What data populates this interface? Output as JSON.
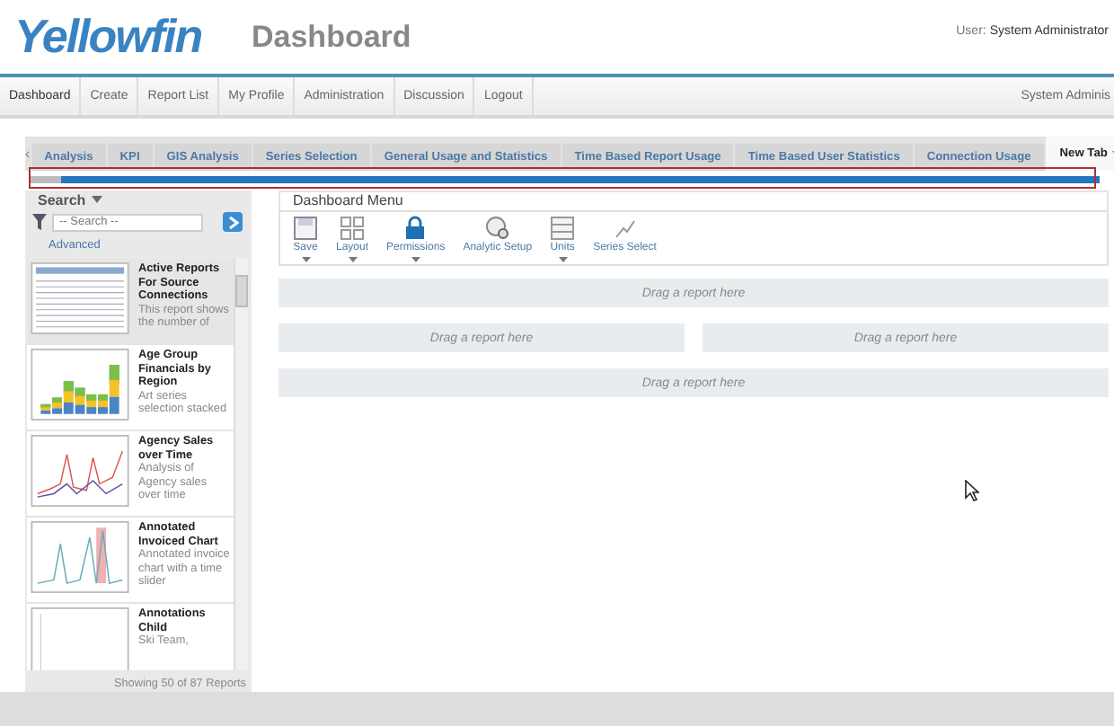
{
  "header": {
    "logo": "Yellowfin",
    "title": "Dashboard",
    "user_label": "User:",
    "user_name": "System Administrator"
  },
  "nav": {
    "items": [
      {
        "label": "Dashboard",
        "selected": true
      },
      {
        "label": "Create",
        "selected": false
      },
      {
        "label": "Report List",
        "selected": false
      },
      {
        "label": "My Profile",
        "selected": false
      },
      {
        "label": "Administration",
        "selected": false
      },
      {
        "label": "Discussion",
        "selected": false
      },
      {
        "label": "Logout",
        "selected": false
      }
    ],
    "user": "System Adminis"
  },
  "tab_scroll_left": "‹",
  "tabs": [
    {
      "label": "Analysis",
      "selected": false
    },
    {
      "label": "KPI",
      "selected": false
    },
    {
      "label": "GIS Analysis",
      "selected": false
    },
    {
      "label": "Series Selection",
      "selected": false
    },
    {
      "label": "General Usage and Statistics",
      "selected": false
    },
    {
      "label": "Time Based Report Usage",
      "selected": false
    },
    {
      "label": "Time Based User Statistics",
      "selected": false
    },
    {
      "label": "Connection Usage",
      "selected": false
    },
    {
      "label": "New Tab",
      "selected": true
    }
  ],
  "loading_bar": {
    "level": 0.97
  },
  "search_panel": {
    "title": "Search",
    "placeholder": "-- Search --",
    "advanced": "Advanced",
    "reports": [
      {
        "title": "Active Reports For Source Connections",
        "description": "This report shows the number of",
        "kind": "table",
        "selected": true
      },
      {
        "title": "Age Group Financials by Region",
        "description": "Art series selection stacked",
        "kind": "bar",
        "selected": false
      },
      {
        "title": "Agency Sales over Time",
        "description": "Analysis of Agency sales over time",
        "kind": "line",
        "selected": false
      },
      {
        "title": "Annotated Invoiced Chart",
        "description": "Annotated invoice chart with a time slider",
        "kind": "annotated",
        "selected": false
      },
      {
        "title": "Annotations Child",
        "description": "Ski Team,",
        "kind": "blank",
        "selected": false
      }
    ],
    "footer": "Showing 50 of 87 Reports"
  },
  "dashboard_menu": {
    "title": "Dashboard Menu",
    "tools": [
      {
        "label": "Save",
        "kind": "save",
        "dropdown": true
      },
      {
        "label": "Layout",
        "kind": "layout",
        "dropdown": true
      },
      {
        "label": "Permissions",
        "kind": "lock",
        "dropdown": true
      },
      {
        "label": "Analytic Setup",
        "kind": "analytic",
        "dropdown": false
      },
      {
        "label": "Units",
        "kind": "units",
        "dropdown": true
      },
      {
        "label": "Series Select",
        "kind": "series",
        "dropdown": false
      }
    ]
  },
  "drop_rows": [
    [
      "Drag a report here"
    ],
    [
      "Drag a report here",
      "Drag a report here"
    ],
    [
      "Drag a report here"
    ]
  ]
}
